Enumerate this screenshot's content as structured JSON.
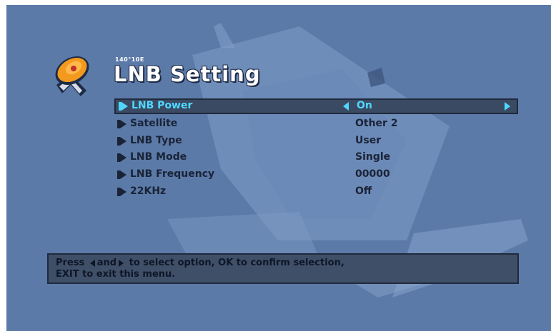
{
  "header": {
    "subtitle": "140°10E",
    "title": "LNB Setting"
  },
  "menu": {
    "items": [
      {
        "label": "LNB Power",
        "value": "On",
        "selected": true
      },
      {
        "label": "Satellite",
        "value": "Other 2",
        "selected": false
      },
      {
        "label": "LNB Type",
        "value": "User",
        "selected": false
      },
      {
        "label": "LNB Mode",
        "value": "Single",
        "selected": false
      },
      {
        "label": "LNB Frequency",
        "value": "00000",
        "selected": false
      },
      {
        "label": "22KHz",
        "value": "Off",
        "selected": false
      }
    ]
  },
  "help": {
    "part1": "Press",
    "part2": "and",
    "part3": "to select option, OK to confirm selection,",
    "line2": "EXIT to exit this menu."
  },
  "colors": {
    "background": "#5b7aa8",
    "highlight_text": "#4fd8ff",
    "dark_text": "#1a2336"
  },
  "icons": {
    "logo": "satellite-dish-icon",
    "bullet": "play-arrow-icon",
    "option_left": "left-arrow-icon",
    "option_right": "right-arrow-icon"
  }
}
